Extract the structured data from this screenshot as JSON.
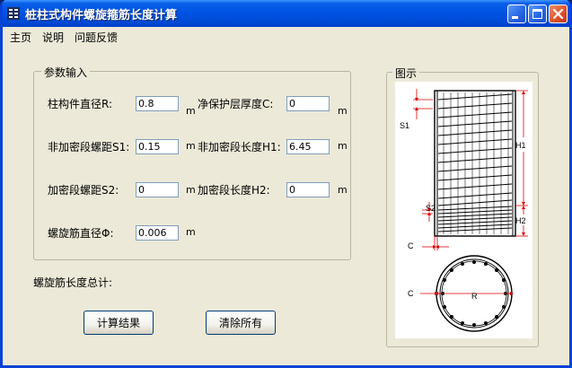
{
  "window": {
    "title": "桩柱式构件螺旋箍筋长度计算"
  },
  "menu": {
    "items": [
      "主页",
      "说明",
      "问题反馈"
    ]
  },
  "input_group": {
    "title": "参数输入",
    "fields": {
      "column_diameter": {
        "label": "柱构件直径R:",
        "value": "0.8",
        "unit": "m"
      },
      "cover_thickness": {
        "label": "净保护层厚度C:",
        "value": "0",
        "unit": "m"
      },
      "non_dense_pitch": {
        "label": "非加密段螺距S1:",
        "value": "0.15",
        "unit": "m"
      },
      "non_dense_length": {
        "label": "非加密段长度H1:",
        "value": "6.45",
        "unit": "m"
      },
      "dense_pitch": {
        "label": "加密段螺距S2:",
        "value": "0",
        "unit": "m"
      },
      "dense_length": {
        "label": "加密段长度H2:",
        "value": "0",
        "unit": "m"
      },
      "spiral_diameter": {
        "label": "螺旋筋直径Φ:",
        "value": "0.006",
        "unit": "m"
      }
    }
  },
  "result": {
    "label": "螺旋筋长度总计:"
  },
  "buttons": {
    "calculate": "计算结果",
    "clear": "清除所有"
  },
  "diagram_group": {
    "title": "图示",
    "labels": {
      "s1": "S1",
      "s2": "S2",
      "h1": "H1",
      "h2": "H2",
      "c_elevation": "C",
      "c_section": "C",
      "r": "R"
    }
  },
  "colors": {
    "title_bar": "#0054e3",
    "window_bg": "#ece9d8",
    "dimension_red": "#e00000",
    "close_button": "#e1532b"
  }
}
